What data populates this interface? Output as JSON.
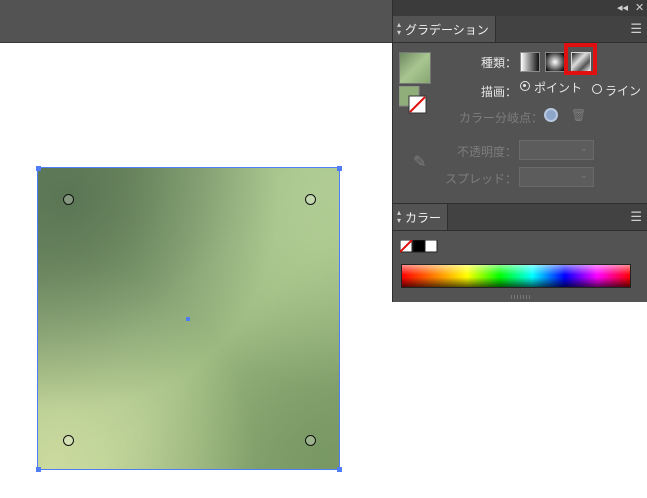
{
  "gradient_panel": {
    "tab_label": "グラデーション",
    "type_label": "種類：",
    "draw_label": "描画：",
    "point_option": "ポイント",
    "line_option": "ライン",
    "color_stop_label": "カラー分岐点：",
    "opacity_label": "不透明度：",
    "spread_label": "スプレッド：",
    "selected_type": "freeform",
    "selected_draw": "point"
  },
  "color_panel": {
    "tab_label": "カラー"
  },
  "window_controls": {
    "collapse": "◂◂",
    "close": "✕"
  },
  "colors": {
    "selection_blue": "#4f7cf7",
    "highlight_red": "#e01010",
    "panel_bg": "#535353",
    "app_bar": "#535353"
  },
  "icons": {
    "menu": "☰",
    "arrows": "◆",
    "chevron": "⌄",
    "trash": "🗑",
    "eyedropper": "✎"
  }
}
